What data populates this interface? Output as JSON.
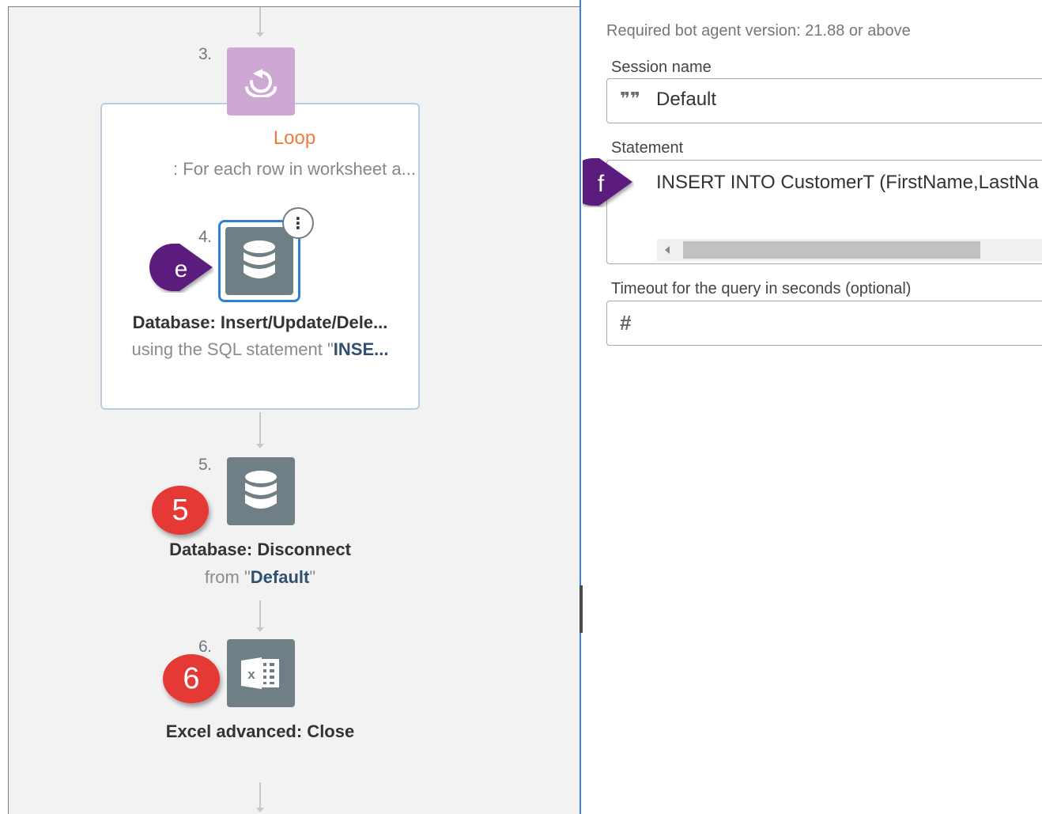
{
  "flow": {
    "step3": {
      "number": "3.",
      "title": "Loop",
      "subtitle": ": For each row in worksheet a..."
    },
    "step4": {
      "number": "4.",
      "title": "Database: Insert/Update/Dele...",
      "subtitle_prefix": "using the SQL statement \"",
      "subtitle_value": "INSE..."
    },
    "step5": {
      "number": "5.",
      "title": "Database: Disconnect",
      "subtitle_prefix": "from \"",
      "subtitle_value": "Default",
      "subtitle_suffix": "\""
    },
    "step6": {
      "number": "6.",
      "title": "Excel advanced: Close"
    },
    "kebab": "⋮"
  },
  "callouts": {
    "e": "e",
    "f": "f",
    "five": "5",
    "six": "6"
  },
  "panel": {
    "required_version": "Required bot agent version: 21.88 or above",
    "session_label": "Session name",
    "session_value": "Default",
    "statement_label": "Statement",
    "statement_value": "INSERT INTO CustomerT (FirstName,LastNa",
    "timeout_label": "Timeout for the query in seconds (optional)",
    "timeout_value": ""
  },
  "icons": {
    "quote": "quote-icon",
    "hash": "hash-icon",
    "loop": "loop-icon",
    "database": "database-icon",
    "excel": "excel-icon"
  },
  "colors": {
    "loop_title": "#f07a3a",
    "accent_blue": "#2f7fd7",
    "callout_purple": "#5c1f7e",
    "callout_red": "#e53935"
  }
}
